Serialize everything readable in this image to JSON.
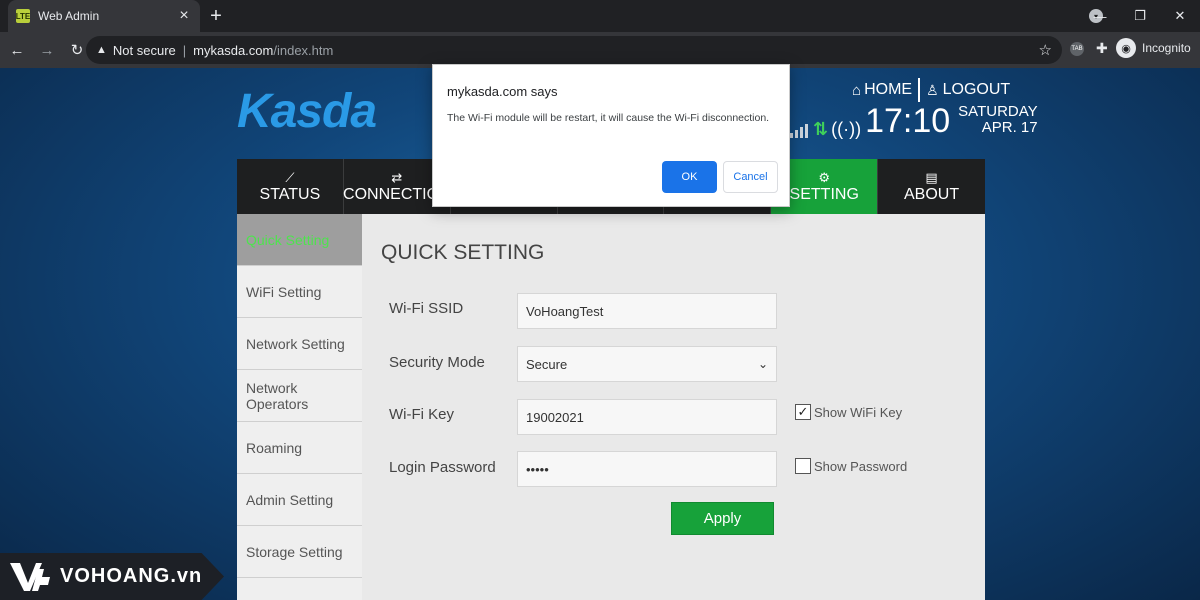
{
  "browser": {
    "tab_title": "Web Admin",
    "tab_favicon_text": "LTE",
    "security_label": "Not secure",
    "url_host": "mykasda.com",
    "url_path": "/index.htm",
    "incognito_label": "Incognito",
    "ext_tab_label": "TAB"
  },
  "header": {
    "logo": "Kasda",
    "home_label": "HOME",
    "logout_label": "LOGOUT",
    "time": "17:10",
    "day": "SATURDAY",
    "date": "APR. 17"
  },
  "nav_tabs": [
    {
      "label": "STATUS",
      "icon": "chart-icon"
    },
    {
      "label": "CONNECTION",
      "icon": "arrows-icon"
    },
    {
      "label": "",
      "icon": ""
    },
    {
      "label": "",
      "icon": ""
    },
    {
      "label": "",
      "icon": ""
    },
    {
      "label": "SETTING",
      "icon": "gears-icon"
    },
    {
      "label": "ABOUT",
      "icon": "info-icon"
    }
  ],
  "sidebar": {
    "items": [
      {
        "label": "Quick Setting",
        "active": true
      },
      {
        "label": "WiFi Setting"
      },
      {
        "label": "Network Setting"
      },
      {
        "label": "Network Operators"
      },
      {
        "label": "Roaming"
      },
      {
        "label": "Admin Setting"
      },
      {
        "label": "Storage Setting"
      }
    ]
  },
  "form": {
    "title": "QUICK SETTING",
    "ssid_label": "Wi-Fi SSID",
    "ssid_value": "VoHoangTest",
    "security_label": "Security Mode",
    "security_value": "Secure",
    "key_label": "Wi-Fi Key",
    "key_value": "19002021",
    "show_key_label": "Show WiFi Key",
    "show_key_checked": true,
    "password_label": "Login Password",
    "password_value": "•••••",
    "show_password_label": "Show Password",
    "show_password_checked": false,
    "apply_label": "Apply"
  },
  "dialog": {
    "title": "mykasda.com says",
    "message": "The Wi-Fi module will be restart, it will cause the Wi-Fi disconnection.",
    "ok_label": "OK",
    "cancel_label": "Cancel"
  },
  "watermark": {
    "text": "VOHOANG.vn"
  },
  "colors": {
    "accent_green": "#17a23a",
    "logo_blue": "#2a9ae6",
    "dialog_blue": "#1a73e8"
  }
}
